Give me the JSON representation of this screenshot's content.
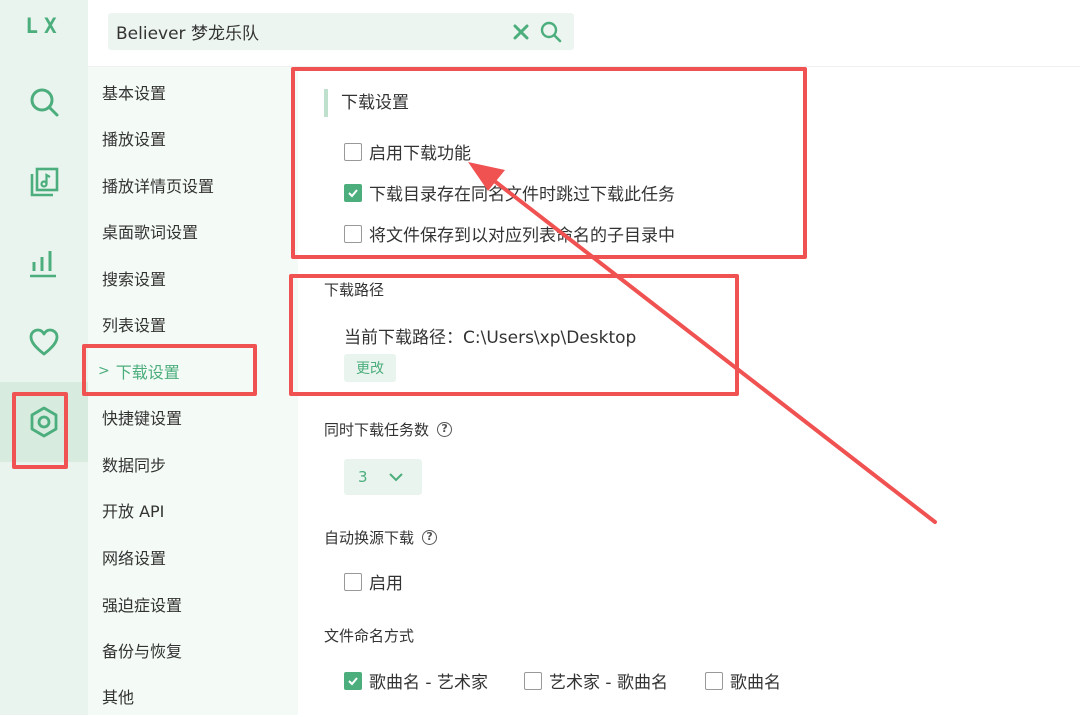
{
  "app": {
    "logo": "LX"
  },
  "rail": {
    "items": [
      {
        "name": "search-icon"
      },
      {
        "name": "music-library-icon"
      },
      {
        "name": "chart-icon"
      },
      {
        "name": "heart-icon"
      },
      {
        "name": "settings-icon",
        "active": true
      }
    ]
  },
  "search": {
    "value": "Believer 梦龙乐队",
    "clear_icon": "close-icon",
    "search_icon": "search-icon"
  },
  "nav": {
    "items": [
      {
        "label": "基本设置"
      },
      {
        "label": "播放设置"
      },
      {
        "label": "播放详情页设置"
      },
      {
        "label": "桌面歌词设置"
      },
      {
        "label": "搜索设置"
      },
      {
        "label": "列表设置"
      },
      {
        "label": "下载设置",
        "active": true,
        "marker": ">"
      },
      {
        "label": "快捷键设置"
      },
      {
        "label": "数据同步"
      },
      {
        "label": "开放 API"
      },
      {
        "label": "网络设置"
      },
      {
        "label": "强迫症设置"
      },
      {
        "label": "备份与恢复"
      },
      {
        "label": "其他"
      }
    ]
  },
  "download": {
    "title": "下载设置",
    "options": [
      {
        "label": "启用下载功能",
        "checked": false
      },
      {
        "label": "下载目录存在同名文件时跳过下载此任务",
        "checked": true
      },
      {
        "label": "将文件保存到以对应列表命名的子目录中",
        "checked": false
      }
    ],
    "path_title": "下载路径",
    "path_label": "当前下载路径：C:\\Users\\xp\\Desktop",
    "change_button": "更改",
    "concurrent_title": "同时下载任务数",
    "concurrent_value": "3",
    "auto_switch_title": "自动换源下载",
    "auto_switch_label": "启用",
    "naming_title": "文件命名方式",
    "naming_options": [
      {
        "label": "歌曲名 - 艺术家",
        "checked": true
      },
      {
        "label": "艺术家 - 歌曲名",
        "checked": false
      },
      {
        "label": "歌曲名",
        "checked": false
      }
    ]
  },
  "colors": {
    "accent": "#4cae7d",
    "annotation": "#f05252",
    "rail_bg": "#eaf4ee"
  }
}
